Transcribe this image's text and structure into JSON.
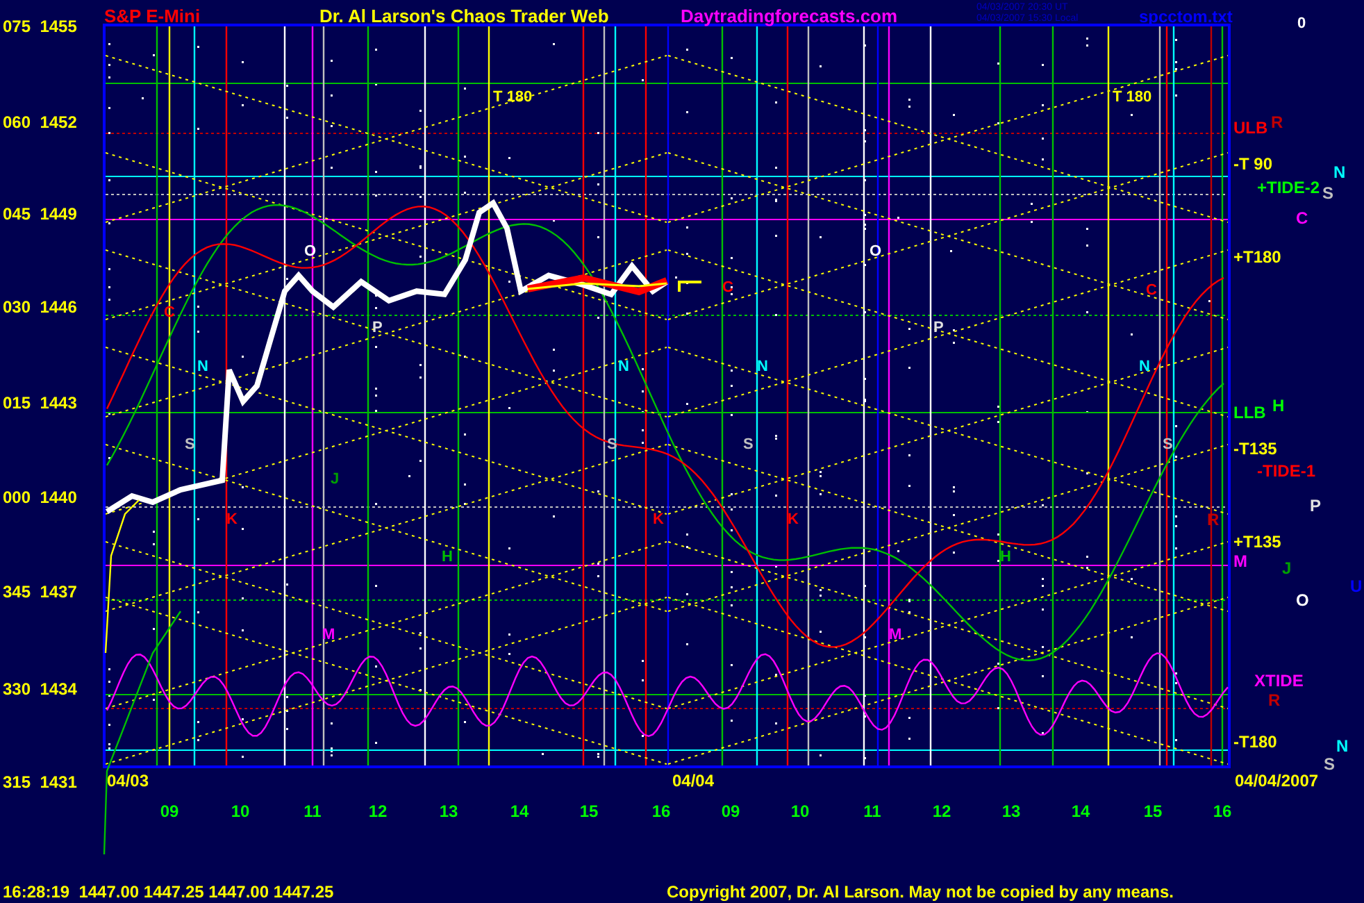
{
  "header": {
    "symbol": "S&P E-Mini",
    "title": "Dr. Al Larson's Chaos Trader Web",
    "site": "Daytradingforecasts.com",
    "timestamps": [
      "04/03/2007 20:30 UT",
      "04/03/2007 15:30 Local"
    ],
    "file": "spcctom.txt",
    "corner": "0"
  },
  "y_axis": [
    {
      "angle": "075",
      "price": "1455"
    },
    {
      "angle": "060",
      "price": "1452"
    },
    {
      "angle": "045",
      "price": "1449"
    },
    {
      "angle": "030",
      "price": "1446"
    },
    {
      "angle": "015",
      "price": "1443"
    },
    {
      "angle": "000",
      "price": "1440"
    },
    {
      "angle": "345",
      "price": "1437"
    },
    {
      "angle": "330",
      "price": "1434"
    },
    {
      "angle": "315",
      "price": "1431"
    }
  ],
  "x_axis": [
    "09",
    "10",
    "11",
    "12",
    "13",
    "14",
    "15",
    "16",
    "09",
    "10",
    "11",
    "12",
    "13",
    "14",
    "15",
    "16"
  ],
  "date_labels": [
    "04/03",
    "04/04",
    "04/04/2007"
  ],
  "right_labels": [
    {
      "text": "ULB",
      "color": "#ff0000"
    },
    {
      "text": "R",
      "color": "#c00000"
    },
    {
      "text": "-T 90",
      "color": "#ffff00"
    },
    {
      "text": "+TIDE-2",
      "color": "#00ff00"
    },
    {
      "text": "N",
      "color": "#00ffff"
    },
    {
      "text": "S",
      "color": "#c0c0c0"
    },
    {
      "text": "C",
      "color": "#ff00ff"
    },
    {
      "text": "+T180",
      "color": "#ffff00"
    },
    {
      "text": "LLB",
      "color": "#00ff00"
    },
    {
      "text": "H",
      "color": "#00ff00"
    },
    {
      "text": "-T135",
      "color": "#ffff00"
    },
    {
      "text": "-TIDE-1",
      "color": "#ff0000"
    },
    {
      "text": "P",
      "color": "#e0e0e0"
    },
    {
      "text": "R",
      "color": "#c00000"
    },
    {
      "text": "+T135",
      "color": "#ffff00"
    },
    {
      "text": "M",
      "color": "#ff00ff"
    },
    {
      "text": "J",
      "color": "#00a000"
    },
    {
      "text": "O",
      "color": "#ffffff"
    },
    {
      "text": "U",
      "color": "#0000ff"
    },
    {
      "text": "XTIDE",
      "color": "#ff00ff"
    },
    {
      "text": "R",
      "color": "#c00000"
    },
    {
      "text": "-T180",
      "color": "#ffff00"
    },
    {
      "text": "N",
      "color": "#00ffff"
    },
    {
      "text": "S",
      "color": "#c0c0c0"
    }
  ],
  "plot_labels": [
    {
      "text": "T 180",
      "color": "#ffff00"
    },
    {
      "text": "T 180",
      "color": "#ffff00"
    },
    {
      "text": "C",
      "color": "#ff0000"
    },
    {
      "text": "O",
      "color": "#ffffff"
    },
    {
      "text": "P",
      "color": "#e0e0e0"
    },
    {
      "text": "N",
      "color": "#00ffff"
    },
    {
      "text": "S",
      "color": "#c0c0c0"
    },
    {
      "text": "K",
      "color": "#ff0000"
    },
    {
      "text": "J",
      "color": "#00a000"
    },
    {
      "text": "M",
      "color": "#ff00ff"
    },
    {
      "text": "H",
      "color": "#00c000"
    },
    {
      "text": "C",
      "color": "#ff0000"
    },
    {
      "text": "O",
      "color": "#ffffff"
    },
    {
      "text": "P",
      "color": "#e0e0e0"
    },
    {
      "text": "N",
      "color": "#00ffff"
    },
    {
      "text": "N",
      "color": "#00ffff"
    },
    {
      "text": "S",
      "color": "#c0c0c0"
    },
    {
      "text": "S",
      "color": "#c0c0c0"
    },
    {
      "text": "K",
      "color": "#ff0000"
    },
    {
      "text": "K",
      "color": "#ff0000"
    },
    {
      "text": "H",
      "color": "#00c000"
    },
    {
      "text": "M",
      "color": "#ff00ff"
    },
    {
      "text": "C",
      "color": "#ff0000"
    },
    {
      "text": "N",
      "color": "#00ffff"
    },
    {
      "text": "S",
      "color": "#c0c0c0"
    }
  ],
  "footer": {
    "quote": "16:28:19  1447.00 1447.25 1447.00 1447.25",
    "copyright": "Copyright 2007, Dr. Al Larson. May not be copied by any means."
  }
}
